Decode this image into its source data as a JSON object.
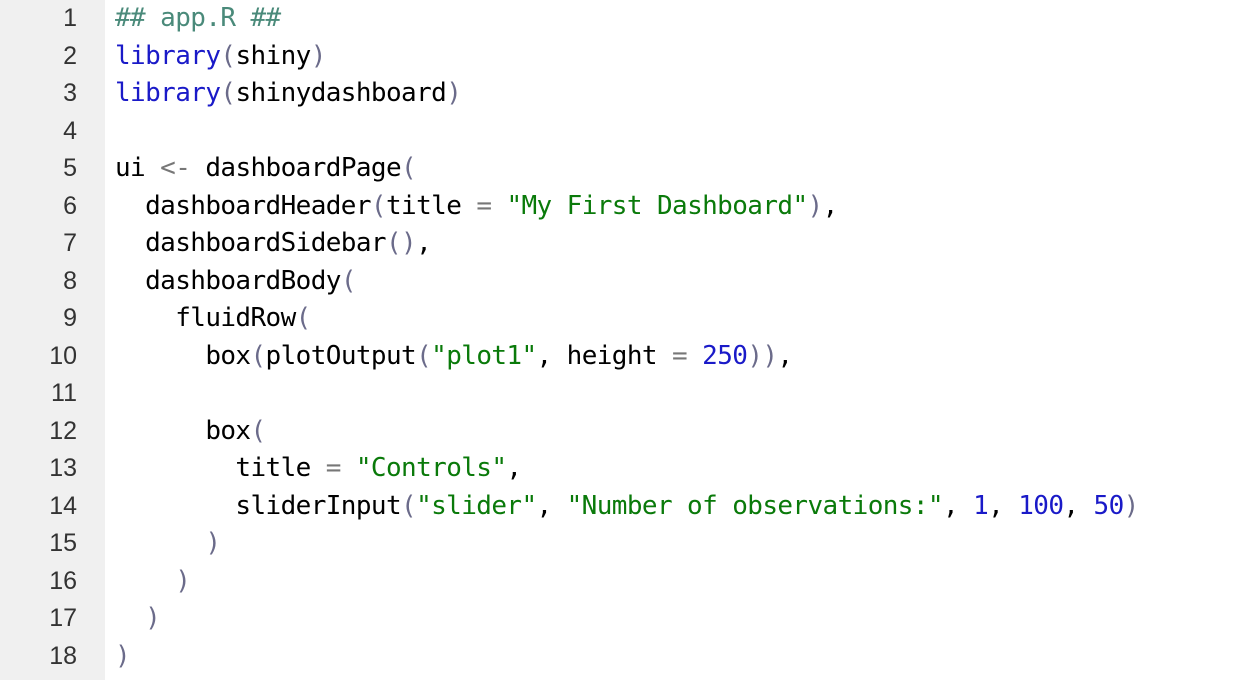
{
  "editor": {
    "colors": {
      "comment": "#4a8a7a",
      "keyword": "#1a1ac8",
      "string": "#0a7a0a",
      "number": "#1a1ac8",
      "operator": "#777777",
      "paren": "#6b6b8a",
      "gutter_bg": "#f0f0f0"
    },
    "lines": [
      {
        "num": "1",
        "tokens": [
          {
            "t": "comment",
            "v": "## app.R ##"
          }
        ]
      },
      {
        "num": "2",
        "tokens": [
          {
            "t": "kw",
            "v": "library"
          },
          {
            "t": "paren",
            "v": "("
          },
          {
            "t": "plain",
            "v": "shiny"
          },
          {
            "t": "paren",
            "v": ")"
          }
        ]
      },
      {
        "num": "3",
        "tokens": [
          {
            "t": "kw",
            "v": "library"
          },
          {
            "t": "paren",
            "v": "("
          },
          {
            "t": "plain",
            "v": "shinydashboard"
          },
          {
            "t": "paren",
            "v": ")"
          }
        ]
      },
      {
        "num": "4",
        "tokens": []
      },
      {
        "num": "5",
        "tokens": [
          {
            "t": "plain",
            "v": "ui "
          },
          {
            "t": "op",
            "v": "<-"
          },
          {
            "t": "plain",
            "v": " dashboardPage"
          },
          {
            "t": "paren",
            "v": "("
          }
        ]
      },
      {
        "num": "6",
        "tokens": [
          {
            "t": "plain",
            "v": "  dashboardHeader"
          },
          {
            "t": "paren",
            "v": "("
          },
          {
            "t": "plain",
            "v": "title "
          },
          {
            "t": "op",
            "v": "="
          },
          {
            "t": "plain",
            "v": " "
          },
          {
            "t": "str",
            "v": "\"My First Dashboard\""
          },
          {
            "t": "paren",
            "v": ")"
          },
          {
            "t": "plain",
            "v": ","
          }
        ]
      },
      {
        "num": "7",
        "tokens": [
          {
            "t": "plain",
            "v": "  dashboardSidebar"
          },
          {
            "t": "paren",
            "v": "()"
          },
          {
            "t": "plain",
            "v": ","
          }
        ]
      },
      {
        "num": "8",
        "tokens": [
          {
            "t": "plain",
            "v": "  dashboardBody"
          },
          {
            "t": "paren",
            "v": "("
          }
        ]
      },
      {
        "num": "9",
        "tokens": [
          {
            "t": "plain",
            "v": "    fluidRow"
          },
          {
            "t": "paren",
            "v": "("
          }
        ]
      },
      {
        "num": "10",
        "tokens": [
          {
            "t": "plain",
            "v": "      box"
          },
          {
            "t": "paren",
            "v": "("
          },
          {
            "t": "plain",
            "v": "plotOutput"
          },
          {
            "t": "paren",
            "v": "("
          },
          {
            "t": "str",
            "v": "\"plot1\""
          },
          {
            "t": "plain",
            "v": ", height "
          },
          {
            "t": "op",
            "v": "="
          },
          {
            "t": "plain",
            "v": " "
          },
          {
            "t": "num",
            "v": "250"
          },
          {
            "t": "paren",
            "v": "))"
          },
          {
            "t": "plain",
            "v": ","
          }
        ]
      },
      {
        "num": "11",
        "tokens": []
      },
      {
        "num": "12",
        "tokens": [
          {
            "t": "plain",
            "v": "      box"
          },
          {
            "t": "paren",
            "v": "("
          }
        ]
      },
      {
        "num": "13",
        "tokens": [
          {
            "t": "plain",
            "v": "        title "
          },
          {
            "t": "op",
            "v": "="
          },
          {
            "t": "plain",
            "v": " "
          },
          {
            "t": "str",
            "v": "\"Controls\""
          },
          {
            "t": "plain",
            "v": ","
          }
        ]
      },
      {
        "num": "14",
        "tokens": [
          {
            "t": "plain",
            "v": "        sliderInput"
          },
          {
            "t": "paren",
            "v": "("
          },
          {
            "t": "str",
            "v": "\"slider\""
          },
          {
            "t": "plain",
            "v": ", "
          },
          {
            "t": "str",
            "v": "\"Number of observations:\""
          },
          {
            "t": "plain",
            "v": ", "
          },
          {
            "t": "num",
            "v": "1"
          },
          {
            "t": "plain",
            "v": ", "
          },
          {
            "t": "num",
            "v": "100"
          },
          {
            "t": "plain",
            "v": ", "
          },
          {
            "t": "num",
            "v": "50"
          },
          {
            "t": "paren",
            "v": ")"
          }
        ]
      },
      {
        "num": "15",
        "tokens": [
          {
            "t": "plain",
            "v": "      "
          },
          {
            "t": "paren",
            "v": ")"
          }
        ]
      },
      {
        "num": "16",
        "tokens": [
          {
            "t": "plain",
            "v": "    "
          },
          {
            "t": "paren",
            "v": ")"
          }
        ]
      },
      {
        "num": "17",
        "tokens": [
          {
            "t": "plain",
            "v": "  "
          },
          {
            "t": "paren",
            "v": ")"
          }
        ]
      },
      {
        "num": "18",
        "tokens": [
          {
            "t": "paren",
            "v": ")"
          }
        ]
      }
    ]
  }
}
